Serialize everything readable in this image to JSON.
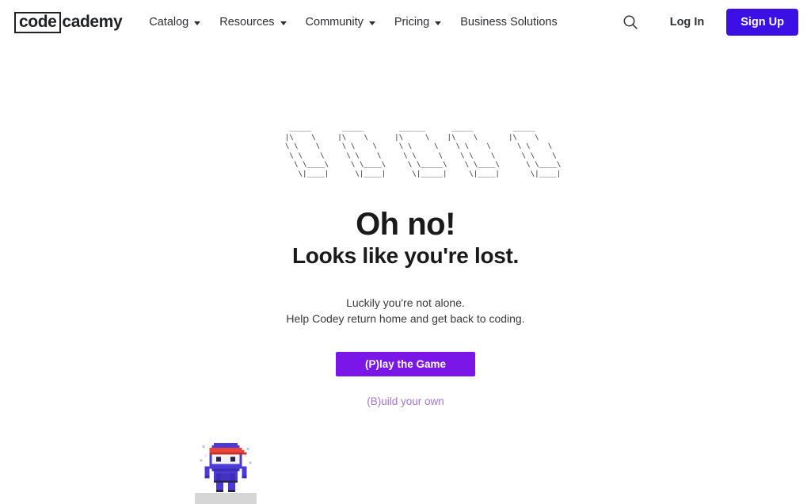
{
  "header": {
    "logo": {
      "boxed": "code",
      "rest": "cademy"
    },
    "nav": [
      {
        "label": "Catalog",
        "has_caret": true
      },
      {
        "label": "Resources",
        "has_caret": true
      },
      {
        "label": "Community",
        "has_caret": true
      },
      {
        "label": "Pricing",
        "has_caret": true
      },
      {
        "label": "Business Solutions",
        "has_caret": false
      }
    ],
    "search_icon": "search-icon",
    "login_label": "Log In",
    "signup_label": "Sign Up"
  },
  "main": {
    "ascii_art": "         _____       _____        ______      _____         _____\n        |\\    \\     |\\    \\      |\\     \\    |\\    \\       |\\    \\\n        \\ \\    \\     \\ \\    \\     \\ \\     \\    \\ \\    \\      \\ \\    \\\n         \\ \\    \\     \\ \\    \\     \\ \\     \\    \\ \\    \\      \\ \\    \\\n          \\ \\____\\     \\ \\____\\     \\ \\_____\\    \\ \\____\\      \\ \\____\\\n           \\|____|      \\|____|      \\|_____|     \\|____|       \\|____|",
    "headline_1": "Oh no!",
    "headline_2": "Looks like you're lost.",
    "subtext_line_1": "Luckily you're not alone.",
    "subtext_line_2": "Help Codey return home and get back to coding.",
    "play_button_label": "(P)lay the Game",
    "build_link_label": "(B)uild your own",
    "codey_alt": "codey-ninja-character",
    "platform_alt": "ground-platform"
  },
  "colors": {
    "signup_bg": "#3a10e5",
    "play_bg": "#7b16e8",
    "build_link": "#a873d8",
    "codey_body": "#4c3ad6",
    "codey_body_dark": "#3b2bb5",
    "codey_headband": "#e8443a",
    "codey_headband_dark": "#c13228",
    "codey_mask": "#f2f2f4",
    "codey_eye": "#2a2350",
    "platform": "#d6d6d6",
    "text_dark": "#1a1a1a"
  }
}
